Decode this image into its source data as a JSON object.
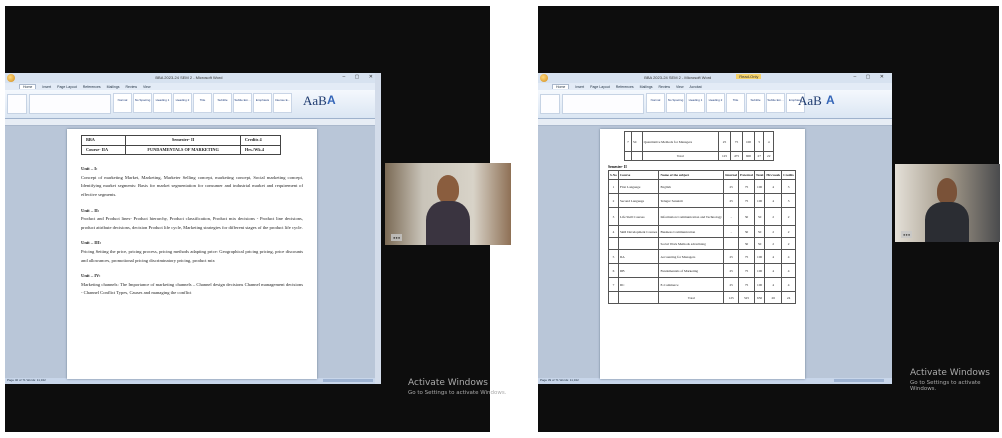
{
  "left": {
    "window_title": "BBA 2023-24 SEM 2 - Microsoft Word",
    "tabs": [
      "Home",
      "Insert",
      "Page Layout",
      "References",
      "Mailings",
      "Review",
      "View"
    ],
    "header_table": [
      [
        "BBA",
        "Semester- II",
        "Credits 4"
      ],
      [
        "Course- IIA",
        "FUNDAMENTALS OF MARKETING",
        "Hrs./Wk.4"
      ]
    ],
    "units": [
      {
        "title": "Unit – I:",
        "text": "Concept of marketing Market, Marketing, Marketer Selling concept, marketing concept, Social marketing concept, Identifying market segments: Basis for market segmentation for consumer and industrial market and requirement of effective segments."
      },
      {
        "title": "Unit – II:",
        "text": "Product and Product lines- Product hierarchy, Product classification, Product mix decisions - Product line decisions, product attribute decisions, decision Product life cycle, Marketing strategies for different stages of the product life cycle."
      },
      {
        "title": "Unit – III:",
        "text": "Pricing Setting the price, pricing process, pricing methods adapting price: Geographical pricing pricing, price discounts and allowances, promotional pricing discriminatory pricing, product mix"
      },
      {
        "title": "Unit – IV:",
        "text": "Marketing channels: The Importance of marketing channels – Channel design decisions Channel management decisions - Channel Conflict Types, Causes and managing the conflict"
      }
    ],
    "status": "Page 40 of 71    Words: 11,342",
    "activate_line1": "Activate Windows",
    "activate_line2": "Go to Settings to activate Windows."
  },
  "right": {
    "window_title": "BBA 2023-24 SEM 2 - Microsoft Word",
    "readonly": "Read-Only",
    "tabs": [
      "Home",
      "Insert",
      "Page Layout",
      "References",
      "Mailings",
      "Review",
      "View",
      "Acrobat"
    ],
    "top_rows": [
      [
        "7",
        "SC",
        "Quantitative Methods for Managers",
        "25",
        "75",
        "100",
        "5",
        "4"
      ],
      [
        "",
        "",
        "Total",
        "125",
        "475",
        "600",
        "27",
        "22"
      ]
    ],
    "semester_label": "Semester- II",
    "columns": [
      "S.No",
      "Course",
      "Name of the subject",
      "Internal",
      "External",
      "Total",
      "Hrs/week",
      "Credits"
    ],
    "rows": [
      [
        "1",
        "First Language",
        "English",
        "25",
        "75",
        "100",
        "4",
        "3"
      ],
      [
        "2",
        "Second Language",
        "Telugu/ Sanskrit",
        "25",
        "75",
        "100",
        "4",
        "3"
      ],
      [
        "3",
        "Life Skill Courses",
        "Information Communication and Technology",
        "-",
        "50",
        "50",
        "2",
        "2"
      ],
      [
        "4",
        "Skill Development Courses",
        "Business Communication",
        "-",
        "50",
        "50",
        "2",
        "2"
      ],
      [
        "",
        "",
        "Social Work Methods advertising",
        "",
        "50",
        "50",
        "2",
        "2"
      ],
      [
        "5",
        "IIA",
        "Accounting for Managers",
        "25",
        "75",
        "100",
        "4",
        "4"
      ],
      [
        "6",
        "IIB",
        "Fundamentals of Marketing",
        "25",
        "75",
        "100",
        "4",
        "4"
      ],
      [
        "7",
        "IIC",
        "E-Commerce",
        "25",
        "75",
        "100",
        "4",
        "4"
      ],
      [
        "",
        "",
        "Total",
        "125",
        "525",
        "650",
        "26",
        "24"
      ]
    ],
    "status": "Page 39 of 71    Words: 11,342",
    "activate_line1": "Activate Windows",
    "activate_line2": "Go to Settings to activate Windows."
  },
  "ribbon_styles": [
    "Normal",
    "No Spacing",
    "Heading 1",
    "Heading 2",
    "Title",
    "Subtitle",
    "Subtle Em...",
    "Emphasis",
    "Intense E..."
  ],
  "big_style": "AaB"
}
